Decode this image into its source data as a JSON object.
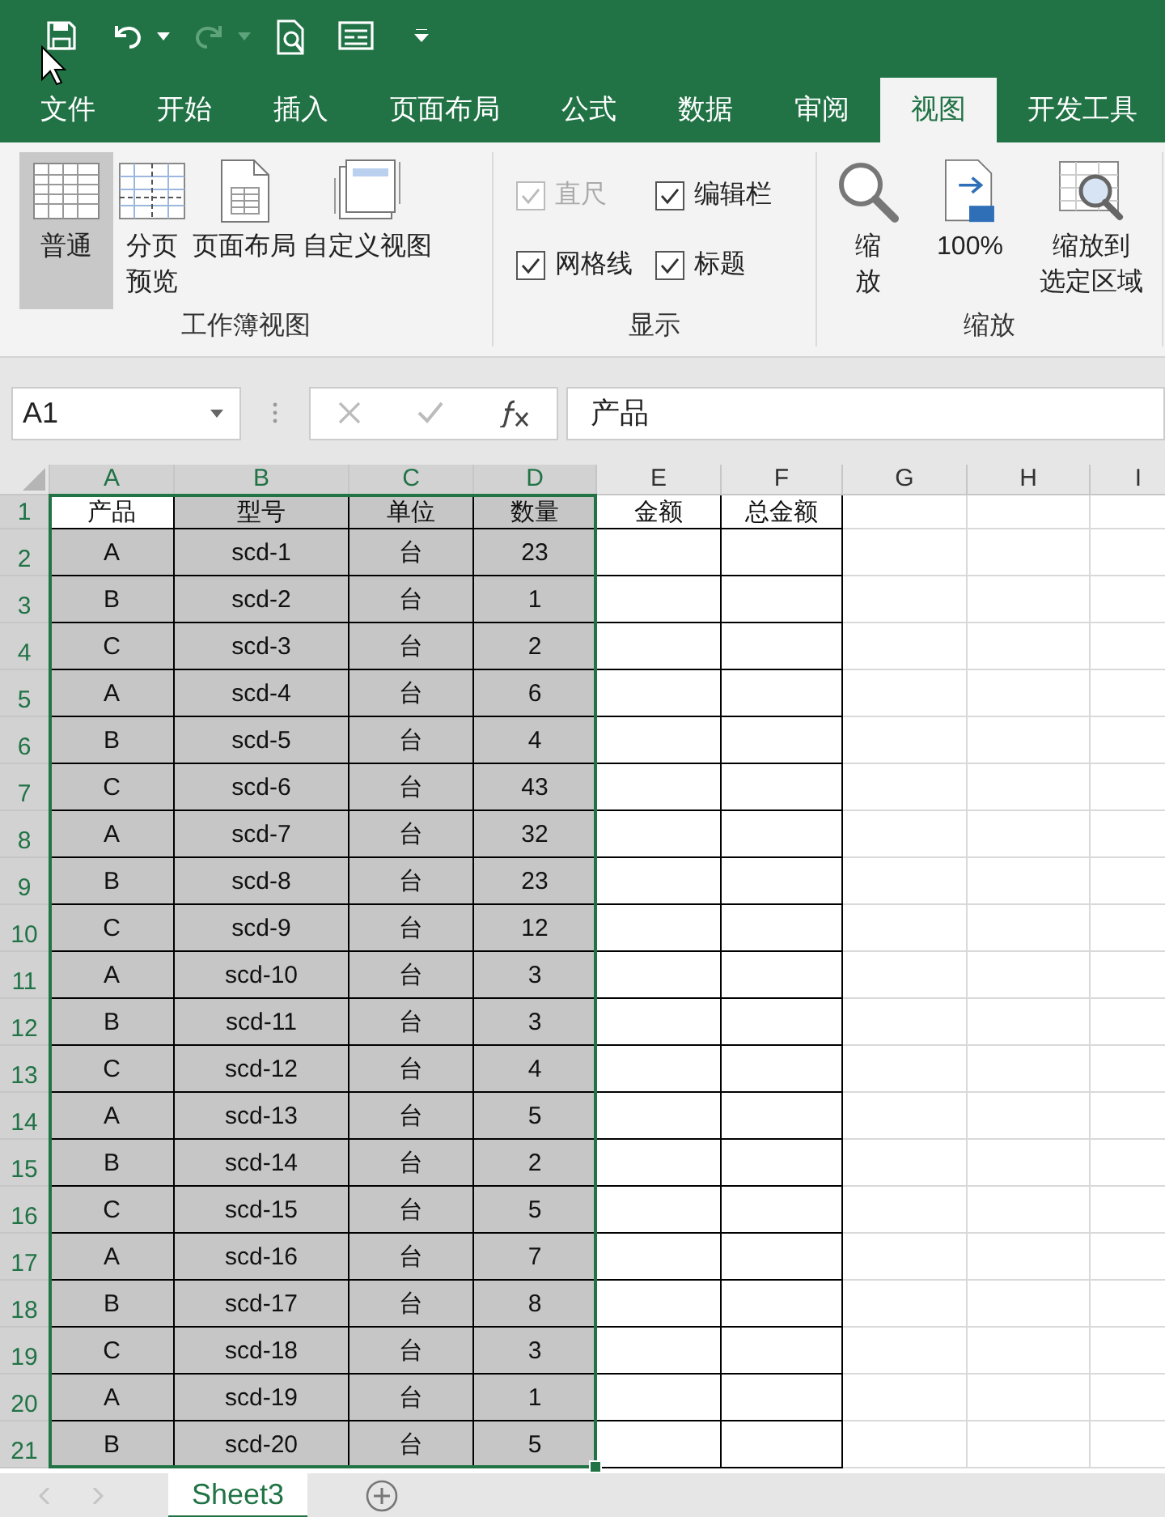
{
  "menu_tabs": [
    {
      "label": "文件",
      "selected": false
    },
    {
      "label": "开始",
      "selected": false
    },
    {
      "label": "插入",
      "selected": false
    },
    {
      "label": "页面布局",
      "selected": false
    },
    {
      "label": "公式",
      "selected": false
    },
    {
      "label": "数据",
      "selected": false
    },
    {
      "label": "审阅",
      "selected": false
    },
    {
      "label": "视图",
      "selected": true
    },
    {
      "label": "开发工具",
      "selected": false
    }
  ],
  "ribbon": {
    "workbook_views": {
      "title": "工作簿视图",
      "buttons": [
        {
          "kind": "normal",
          "label_lines": [
            "普通"
          ],
          "selected": true
        },
        {
          "kind": "pagebreak",
          "label_lines": [
            "分页",
            "预览"
          ],
          "selected": false
        },
        {
          "kind": "pagelayout",
          "label_lines": [
            "页面布局"
          ],
          "selected": false
        },
        {
          "kind": "custom",
          "label_lines": [
            "自定义视图"
          ],
          "selected": false
        }
      ]
    },
    "show": {
      "title": "显示",
      "options": [
        {
          "label": "直尺",
          "checked": true,
          "disabled": true
        },
        {
          "label": "编辑栏",
          "checked": true,
          "disabled": false
        },
        {
          "label": "网格线",
          "checked": true,
          "disabled": false
        },
        {
          "label": "标题",
          "checked": true,
          "disabled": false
        }
      ]
    },
    "zoom": {
      "title": "缩放",
      "buttons": [
        {
          "kind": "zoom",
          "label_lines": [
            "缩",
            "放"
          ]
        },
        {
          "kind": "hundred",
          "label_lines": [
            "100%"
          ]
        },
        {
          "kind": "selection",
          "label_lines": [
            "缩放到",
            "选定区域"
          ]
        }
      ]
    }
  },
  "name_box": "A1",
  "formula": "产品",
  "columns": [
    {
      "label": "A",
      "selected": true,
      "bordered": true
    },
    {
      "label": "B",
      "selected": true,
      "bordered": true
    },
    {
      "label": "C",
      "selected": true,
      "bordered": true
    },
    {
      "label": "D",
      "selected": true,
      "bordered": true
    },
    {
      "label": "E",
      "selected": false,
      "bordered": true
    },
    {
      "label": "F",
      "selected": false,
      "bordered": true
    },
    {
      "label": "G",
      "selected": false,
      "bordered": false
    },
    {
      "label": "H",
      "selected": false,
      "bordered": false
    },
    {
      "label": "I",
      "selected": false,
      "bordered": false
    }
  ],
  "rows": [
    {
      "number": "1",
      "selected": true,
      "active": true,
      "cells": [
        "产品",
        "型号",
        "单位",
        "数量",
        "金额",
        "总金额"
      ]
    },
    {
      "number": "2",
      "selected": true,
      "active": false,
      "cells": [
        "A",
        "scd-1",
        "台",
        "23"
      ]
    },
    {
      "number": "3",
      "selected": true,
      "active": false,
      "cells": [
        "B",
        "scd-2",
        "台",
        "1"
      ]
    },
    {
      "number": "4",
      "selected": true,
      "active": false,
      "cells": [
        "C",
        "scd-3",
        "台",
        "2"
      ]
    },
    {
      "number": "5",
      "selected": true,
      "active": false,
      "cells": [
        "A",
        "scd-4",
        "台",
        "6"
      ]
    },
    {
      "number": "6",
      "selected": true,
      "active": false,
      "cells": [
        "B",
        "scd-5",
        "台",
        "4"
      ]
    },
    {
      "number": "7",
      "selected": true,
      "active": false,
      "cells": [
        "C",
        "scd-6",
        "台",
        "43"
      ]
    },
    {
      "number": "8",
      "selected": true,
      "active": false,
      "cells": [
        "A",
        "scd-7",
        "台",
        "32"
      ]
    },
    {
      "number": "9",
      "selected": true,
      "active": false,
      "cells": [
        "B",
        "scd-8",
        "台",
        "23"
      ]
    },
    {
      "number": "10",
      "selected": true,
      "active": false,
      "cells": [
        "C",
        "scd-9",
        "台",
        "12"
      ]
    },
    {
      "number": "11",
      "selected": true,
      "active": false,
      "cells": [
        "A",
        "scd-10",
        "台",
        "3"
      ]
    },
    {
      "number": "12",
      "selected": true,
      "active": false,
      "cells": [
        "B",
        "scd-11",
        "台",
        "3"
      ]
    },
    {
      "number": "13",
      "selected": true,
      "active": false,
      "cells": [
        "C",
        "scd-12",
        "台",
        "4"
      ]
    },
    {
      "number": "14",
      "selected": true,
      "active": false,
      "cells": [
        "A",
        "scd-13",
        "台",
        "5"
      ]
    },
    {
      "number": "15",
      "selected": true,
      "active": false,
      "cells": [
        "B",
        "scd-14",
        "台",
        "2"
      ]
    },
    {
      "number": "16",
      "selected": true,
      "active": false,
      "cells": [
        "C",
        "scd-15",
        "台",
        "5"
      ]
    },
    {
      "number": "17",
      "selected": true,
      "active": false,
      "cells": [
        "A",
        "scd-16",
        "台",
        "7"
      ]
    },
    {
      "number": "18",
      "selected": true,
      "active": false,
      "cells": [
        "B",
        "scd-17",
        "台",
        "8"
      ]
    },
    {
      "number": "19",
      "selected": true,
      "active": false,
      "cells": [
        "C",
        "scd-18",
        "台",
        "3"
      ]
    },
    {
      "number": "20",
      "selected": true,
      "active": false,
      "cells": [
        "A",
        "scd-19",
        "台",
        "1"
      ]
    },
    {
      "number": "21",
      "selected": true,
      "active": false,
      "cells": [
        "B",
        "scd-20",
        "台",
        "5"
      ]
    }
  ],
  "sheet_tabs": [
    {
      "label": "Sheet3",
      "selected": true
    }
  ]
}
